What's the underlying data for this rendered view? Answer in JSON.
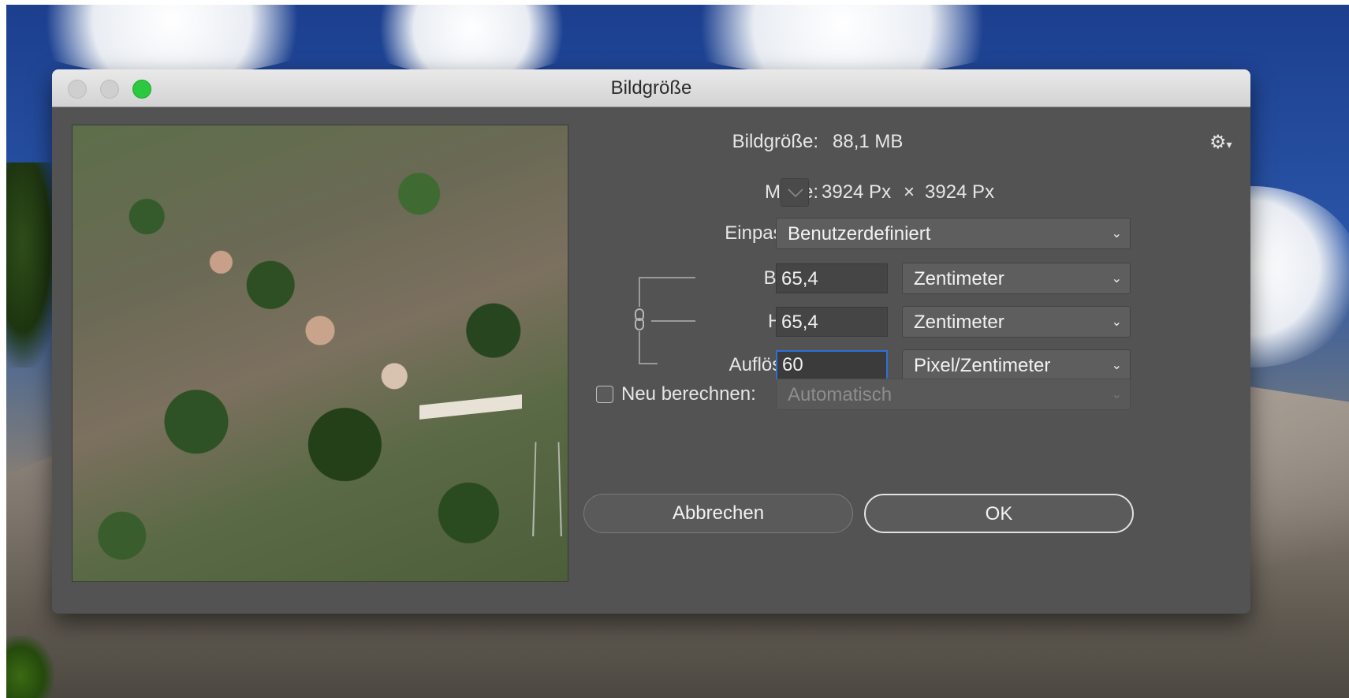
{
  "window": {
    "title": "Bildgröße"
  },
  "image_size": {
    "label": "Bildgröße:",
    "value": "88,1 MB"
  },
  "dimensions": {
    "label": "Maße:",
    "width": "3924 Px",
    "times": "×",
    "height": "3924 Px"
  },
  "fit": {
    "label": "Einpassen:",
    "selected": "Benutzerdefiniert"
  },
  "width": {
    "label": "Breite:",
    "value": "65,4",
    "unit": "Zentimeter"
  },
  "height": {
    "label": "Höhe:",
    "value": "65,4",
    "unit": "Zentimeter"
  },
  "resolution": {
    "label": "Auflösung:",
    "value": "60",
    "unit": "Pixel/Zentimeter"
  },
  "resample": {
    "label": "Neu berechnen:",
    "checked": false,
    "selected": "Automatisch"
  },
  "buttons": {
    "cancel": "Abbrechen",
    "ok": "OK"
  },
  "icons": {
    "gear": "gear-icon",
    "link": "chain-link-icon",
    "chevron": "chevron-down-icon"
  },
  "colors": {
    "dialog_bg": "#535353",
    "focus_border": "#2f6fd6",
    "zoom_button": "#2bc840"
  }
}
